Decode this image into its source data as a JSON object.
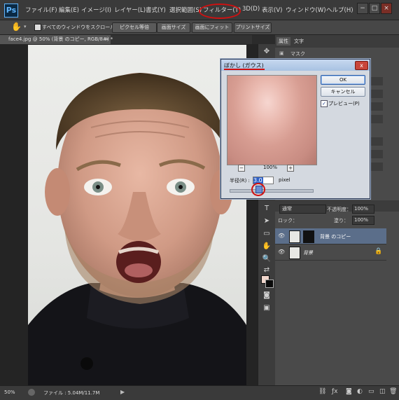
{
  "app": {
    "logo": "Ps"
  },
  "menu": {
    "items": [
      "ファイル(F)",
      "編集(E)",
      "イメージ(I)",
      "レイヤー(L)",
      "書式(Y)",
      "選択範囲(S)",
      "フィルター(T)",
      "3D(D)",
      "表示(V)",
      "ウィンドウ(W)",
      "ヘルプ(H)"
    ],
    "window_controls": [
      "−",
      "□",
      "×"
    ]
  },
  "options": {
    "checkbox_label": "すべてのウィンドウをスクロール",
    "buttons": [
      "ピクセル等倍",
      "画面サイズ",
      "画面にフィット",
      "プリントサイズ"
    ]
  },
  "document": {
    "tab_title": "face4.jpg @ 50% (背景 のコピー, RGB/8#) *",
    "tab_close": "×",
    "zoom": "50%",
    "file_info": "ファイル : 5.04M/11.7M"
  },
  "panels": {
    "tabs": [
      "属性",
      "文字"
    ],
    "mask_label": "マスク",
    "blend_mode": "通常",
    "opacity_label": "不透明度：",
    "opacity_value": "100%",
    "lock_label": "ロック：",
    "fill_label": "塗り：",
    "fill_value": "100%",
    "layers": [
      {
        "name": "背景 のコピー"
      },
      {
        "name": "背景"
      }
    ]
  },
  "dialog": {
    "title": "ぼかし (ガウス)",
    "ok": "OK",
    "cancel": "キャンセル",
    "preview_label": "プレビュー(P)",
    "preview_checked": true,
    "zoom": "100%",
    "zoom_minus": "−",
    "zoom_plus": "+",
    "radius_label": "半径(R) :",
    "radius_value": "3.0",
    "radius_unit": "pixel",
    "close": "x"
  },
  "colors": {
    "accent_red": "#d01010",
    "ps_blue": "#5fb5ff"
  }
}
